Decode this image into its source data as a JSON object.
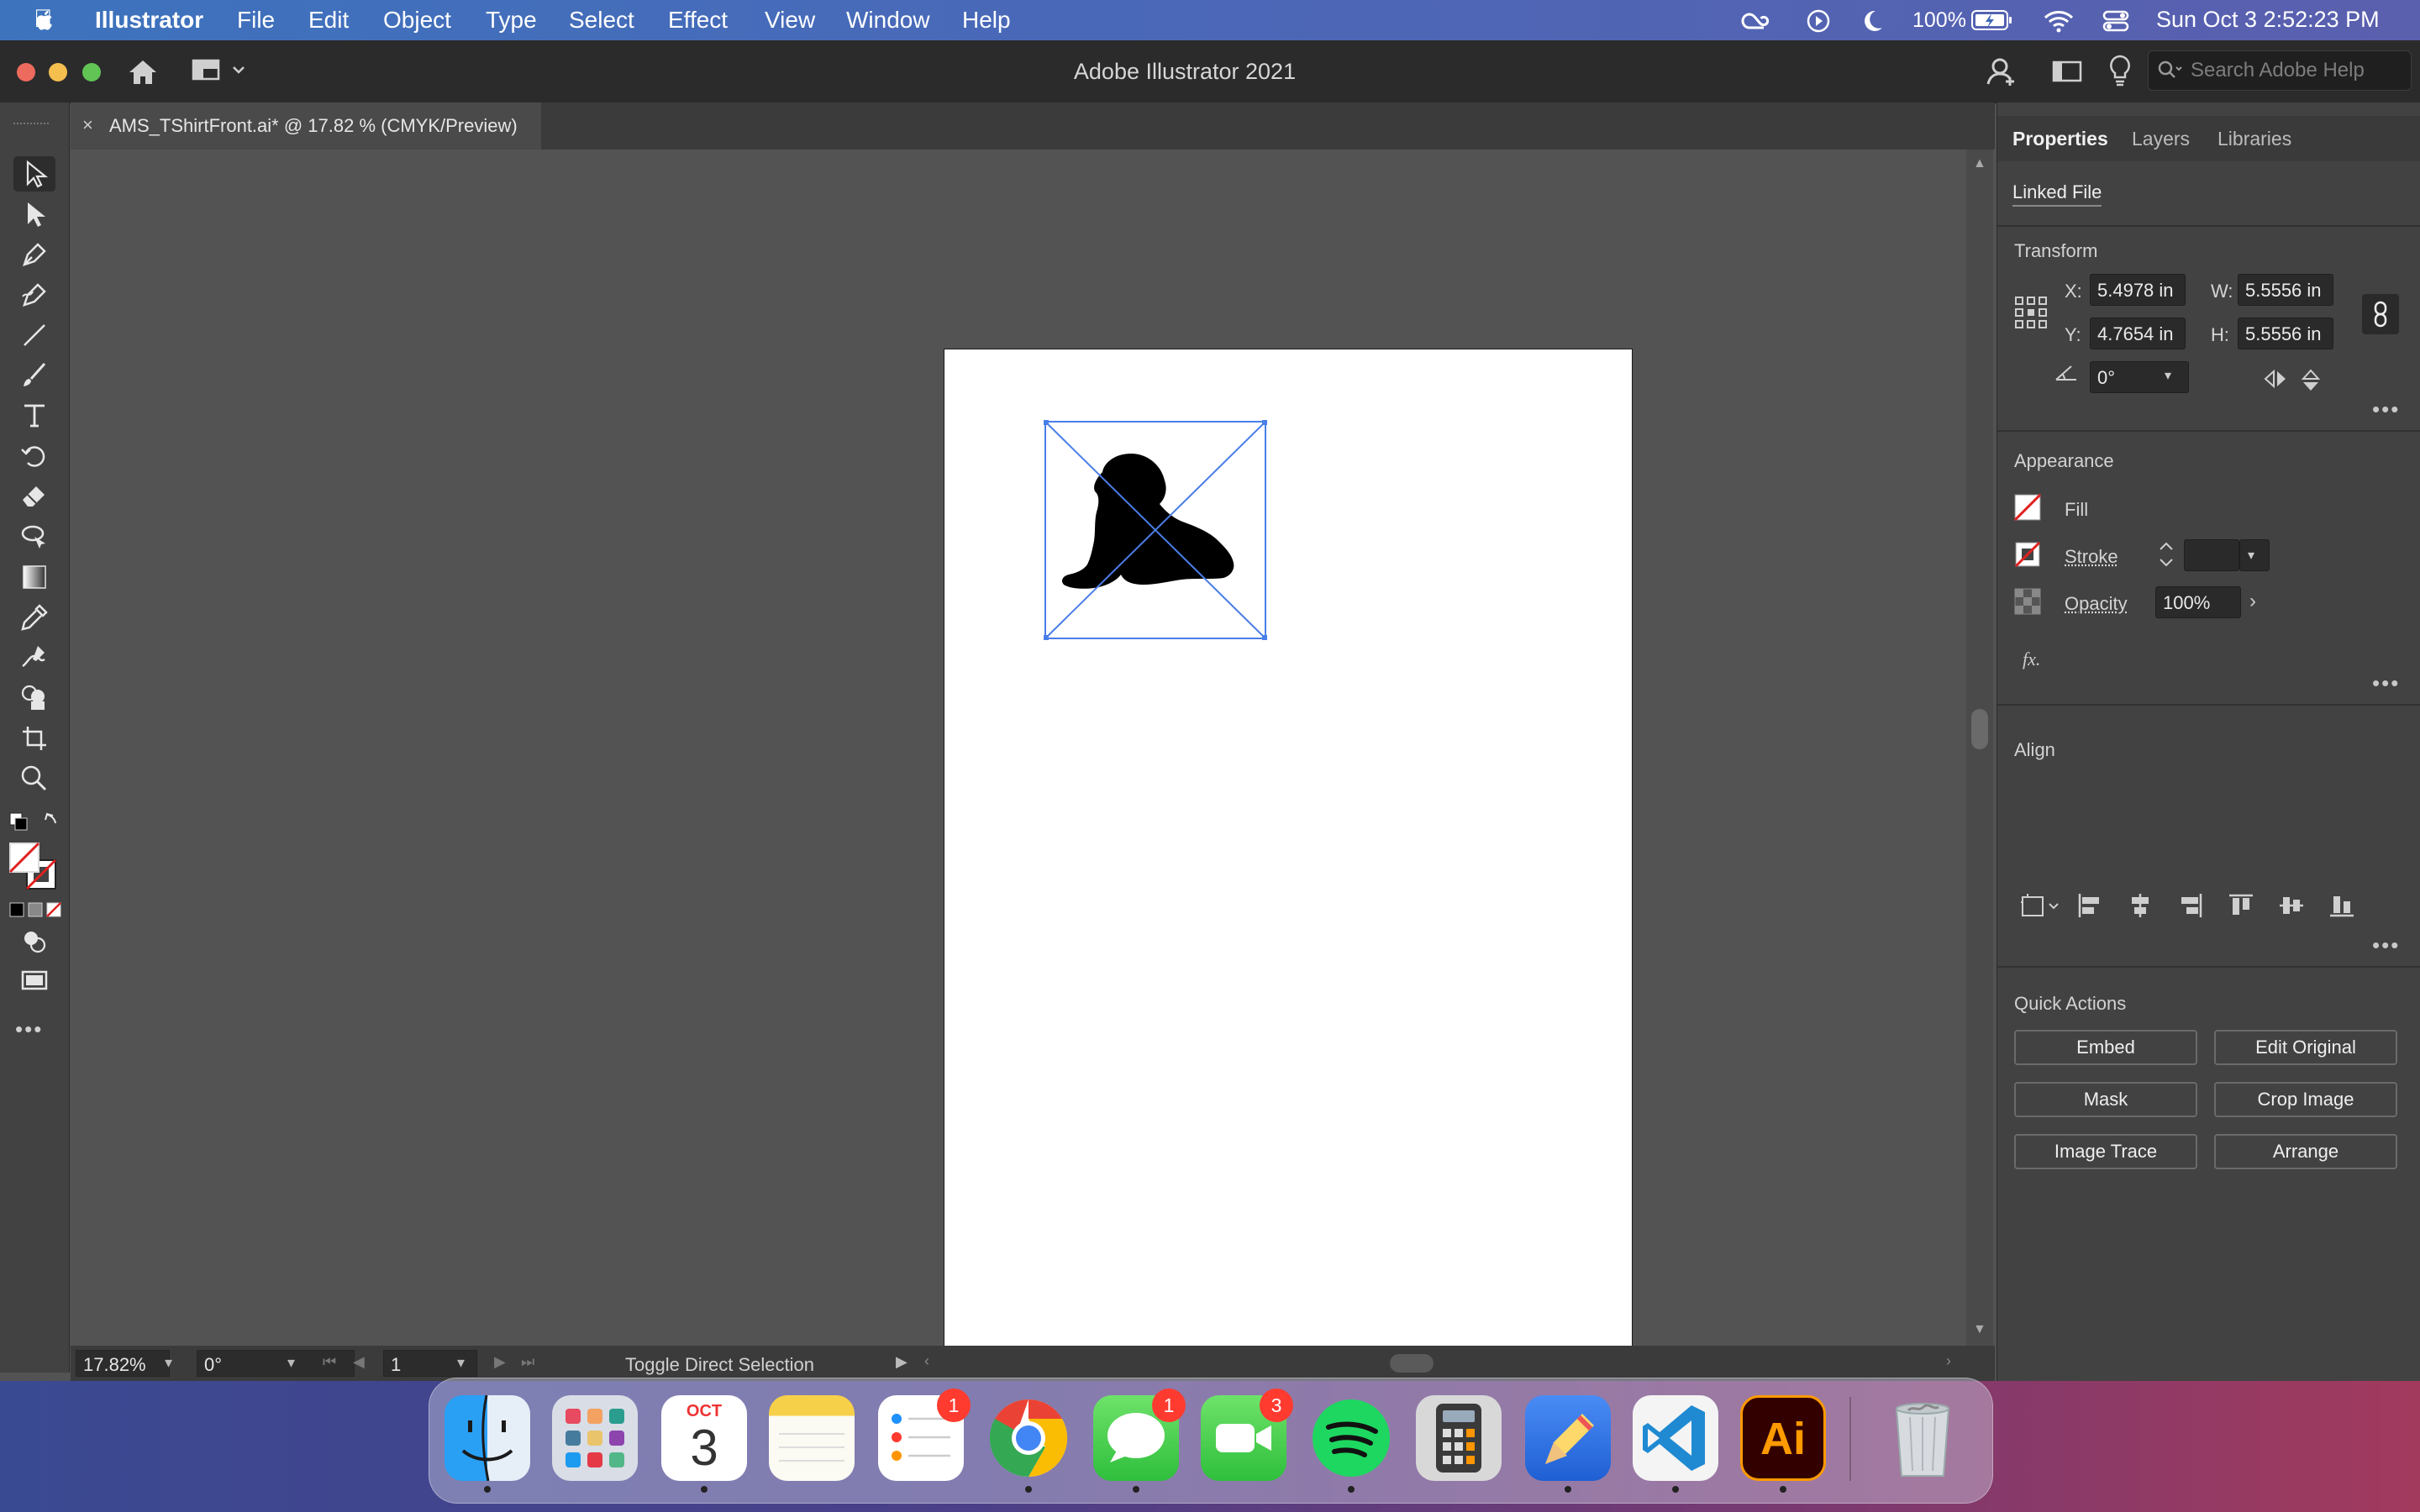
{
  "menubar": {
    "app_name": "Illustrator",
    "items": [
      "File",
      "Edit",
      "Object",
      "Type",
      "Select",
      "Effect",
      "View",
      "Window",
      "Help"
    ],
    "battery": "100%",
    "datetime": "Sun Oct 3  2:52:23 PM"
  },
  "window": {
    "title": "Adobe Illustrator 2021",
    "search_placeholder": "Search Adobe Help"
  },
  "document": {
    "tab_title": "AMS_TShirtFront.ai* @ 17.82 % (CMYK/Preview)",
    "close_glyph": "×"
  },
  "statusbar": {
    "zoom": "17.82%",
    "rotation": "0°",
    "artboard": "1",
    "status_text": "Toggle Direct Selection"
  },
  "panel": {
    "tabs": [
      "Properties",
      "Layers",
      "Libraries"
    ],
    "object_type": "Linked File",
    "transform": {
      "title": "Transform",
      "x_label": "X:",
      "x": "5.4978 in",
      "y_label": "Y:",
      "y": "4.7654 in",
      "w_label": "W:",
      "w": "5.5556 in",
      "h_label": "H:",
      "h": "5.5556 in",
      "angle": "0°"
    },
    "appearance": {
      "title": "Appearance",
      "fill_label": "Fill",
      "stroke_label": "Stroke",
      "opacity_label": "Opacity",
      "opacity": "100%",
      "fx_label": "fx."
    },
    "align": {
      "title": "Align"
    },
    "quick_actions": {
      "title": "Quick Actions",
      "buttons": [
        "Embed",
        "Edit Original",
        "Mask",
        "Crop Image",
        "Image Trace",
        "Arrange"
      ]
    }
  },
  "dock": {
    "calendar_month": "OCT",
    "calendar_day": "3",
    "reminders_badge": "1",
    "messages_badge": "1",
    "facetime_badge": "3",
    "illustrator_label": "Ai"
  },
  "colors": {
    "selection": "#4a7ee8",
    "panel_bg": "#424242",
    "canvas_bg": "#535353",
    "illustrator_brand": "#ff9a00"
  }
}
